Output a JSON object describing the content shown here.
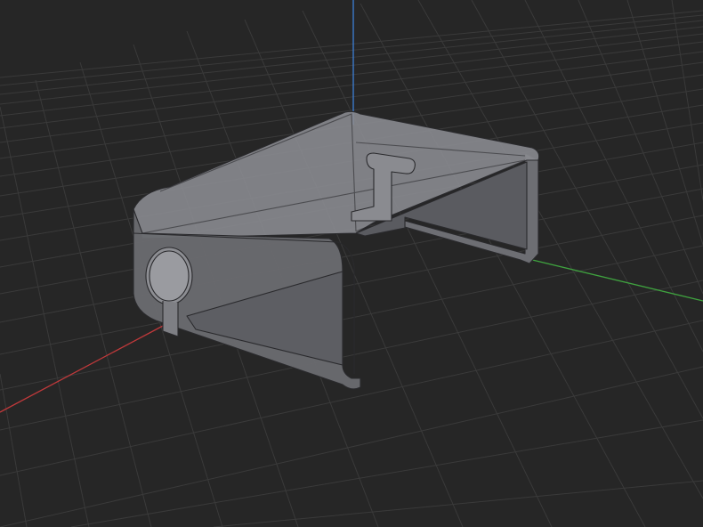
{
  "viewport": {
    "background": "#262626",
    "grid_color": "#3a3a3a",
    "grid_major_color": "#444444"
  },
  "axes": {
    "x_color": "#c0393b",
    "y_color": "#3fa23f",
    "z_color": "#3d7fd6"
  },
  "model": {
    "shape": "bent-sheet-bracket",
    "body_color": "#7a7b80",
    "edge_color": "#2a2a2d",
    "opacity": 0.55
  }
}
